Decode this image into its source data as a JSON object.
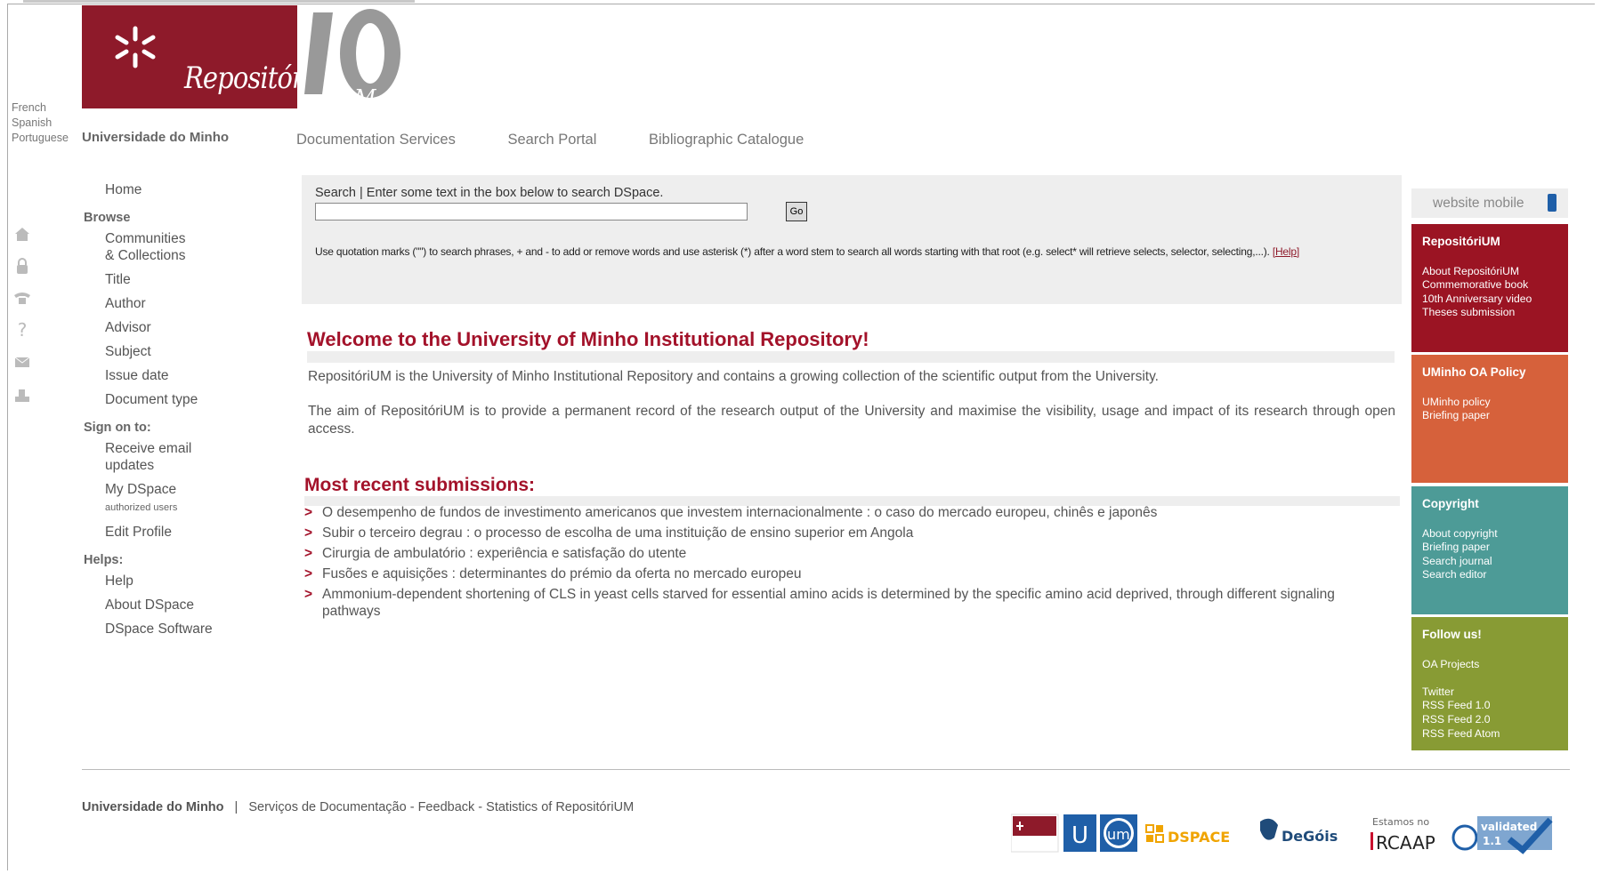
{
  "languages": [
    "French",
    "Spanish",
    "Portuguese"
  ],
  "logo": {
    "name": "RepositóriUM",
    "university": "Universidade do Minho"
  },
  "topnav": [
    "Documentation Services",
    "Search Portal",
    "Bibliographic Catalogue"
  ],
  "leftnav": {
    "home": "Home",
    "browse_heading": "Browse",
    "browse": [
      "Communities\n& Collections",
      "Title",
      "Author",
      "Advisor",
      "Subject",
      "Issue date",
      "Document type"
    ],
    "sign_heading": "Sign on to:",
    "receive": "Receive email updates",
    "mydspace": "My DSpace",
    "mydspace_sub": "authorized users",
    "edit_profile": "Edit Profile",
    "helps_heading": "Helps:",
    "helps": [
      "Help",
      "About DSpace",
      "DSpace Software"
    ]
  },
  "search": {
    "label": "Search | Enter some text in the box below to search DSpace.",
    "go": "Go",
    "note": "Use quotation marks (\"\") to search phrases, + and - to add or remove words and use asterisk (*) after a word stem to search all words starting with that root (e.g. select* will retrieve selects, selector, selecting,...).",
    "help": "[Help]"
  },
  "main": {
    "welcome": "Welcome to the University of Minho Institutional Repository!",
    "p1": "RepositóriUM is the University of Minho Institutional Repository and contains a growing collection of the scientific output from the University.",
    "p2": "The aim of RepositóriUM is to provide a permanent record of the research output of the University and maximise the visibility, usage and impact of its research through open access.",
    "recent_heading": "Most recent submissions:",
    "recent": [
      "O desempenho de fundos de investimento americanos que investem internacionalmente : o caso do mercado europeu, chinês e japonês",
      "Subir o terceiro degrau : o processo de escolha de uma instituição de ensino superior em Angola",
      "Cirurgia de ambulatório : experiência e satisfação do utente",
      "Fusões e aquisições : determinantes do prémio da oferta no mercado europeu",
      "Ammonium-dependent shortening of CLS in yeast cells starved for essential amino acids is determined by the specific amino acid deprived, through different signaling pathways"
    ]
  },
  "right": {
    "mobile": "website mobile",
    "boxes": [
      {
        "title": "RepositóriUM",
        "color": "#9b1423",
        "links": [
          "About RepositóriUM",
          "Commemorative book",
          "10th Anniversary video",
          "Theses submission"
        ]
      },
      {
        "title": "UMinho OA Policy",
        "color": "#d6613b",
        "links": [
          "UMinho policy",
          "Briefing paper"
        ]
      },
      {
        "title": "Copyright",
        "color": "#4d9b97",
        "links": [
          "About copyright",
          "Briefing paper",
          "Search journal",
          "Search editor"
        ]
      },
      {
        "title": "Follow us!",
        "color": "#889b34",
        "links": [
          "OA Projects",
          "",
          "Twitter",
          "RSS Feed 1.0",
          "RSS Feed 2.0",
          "RSS Feed Atom"
        ]
      }
    ]
  },
  "footer": {
    "univ": "Universidade do Minho",
    "sep": "|",
    "links": [
      "Serviços de Documentação",
      "Feedback",
      "Statistics of RepositóriUM"
    ],
    "logos": [
      "DSPACE",
      "DeGóis",
      "Estamos no",
      "RCAAP",
      "validated 1.1"
    ]
  }
}
